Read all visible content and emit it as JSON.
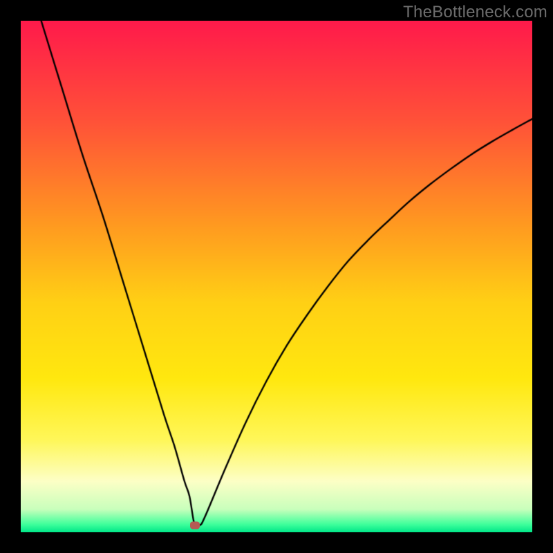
{
  "watermark": "TheBottleneck.com",
  "colors": {
    "frame": "#000000",
    "curve": "#000000",
    "marker": "#b65a54",
    "gradient_stops": [
      {
        "t": 0.0,
        "color": "#ff1a4b"
      },
      {
        "t": 0.2,
        "color": "#ff5338"
      },
      {
        "t": 0.4,
        "color": "#ff9a20"
      },
      {
        "t": 0.55,
        "color": "#ffd015"
      },
      {
        "t": 0.7,
        "color": "#ffe80f"
      },
      {
        "t": 0.82,
        "color": "#fff75a"
      },
      {
        "t": 0.9,
        "color": "#fdffc6"
      },
      {
        "t": 0.955,
        "color": "#c9ffbc"
      },
      {
        "t": 0.985,
        "color": "#3dff9b"
      },
      {
        "t": 1.0,
        "color": "#00e688"
      }
    ]
  },
  "chart_data": {
    "type": "line",
    "title": "",
    "xlabel": "",
    "ylabel": "",
    "xlim": [
      0,
      100
    ],
    "ylim": [
      0,
      100
    ],
    "x": [
      4,
      8,
      12,
      16,
      20,
      24,
      28,
      30,
      32,
      33,
      34,
      35,
      36,
      40,
      44,
      48,
      52,
      56,
      60,
      64,
      68,
      72,
      76,
      80,
      84,
      88,
      92,
      96,
      100
    ],
    "values": [
      100,
      87,
      74,
      62,
      49,
      36,
      23,
      17,
      10,
      7,
      1.4,
      1.4,
      3,
      12.5,
      21.5,
      29.5,
      36.5,
      42.5,
      48,
      53,
      57.2,
      61,
      64.7,
      68,
      71,
      73.8,
      76.3,
      78.6,
      80.8
    ],
    "min_point": {
      "x": 34,
      "y": 1.4
    },
    "annotations": []
  }
}
